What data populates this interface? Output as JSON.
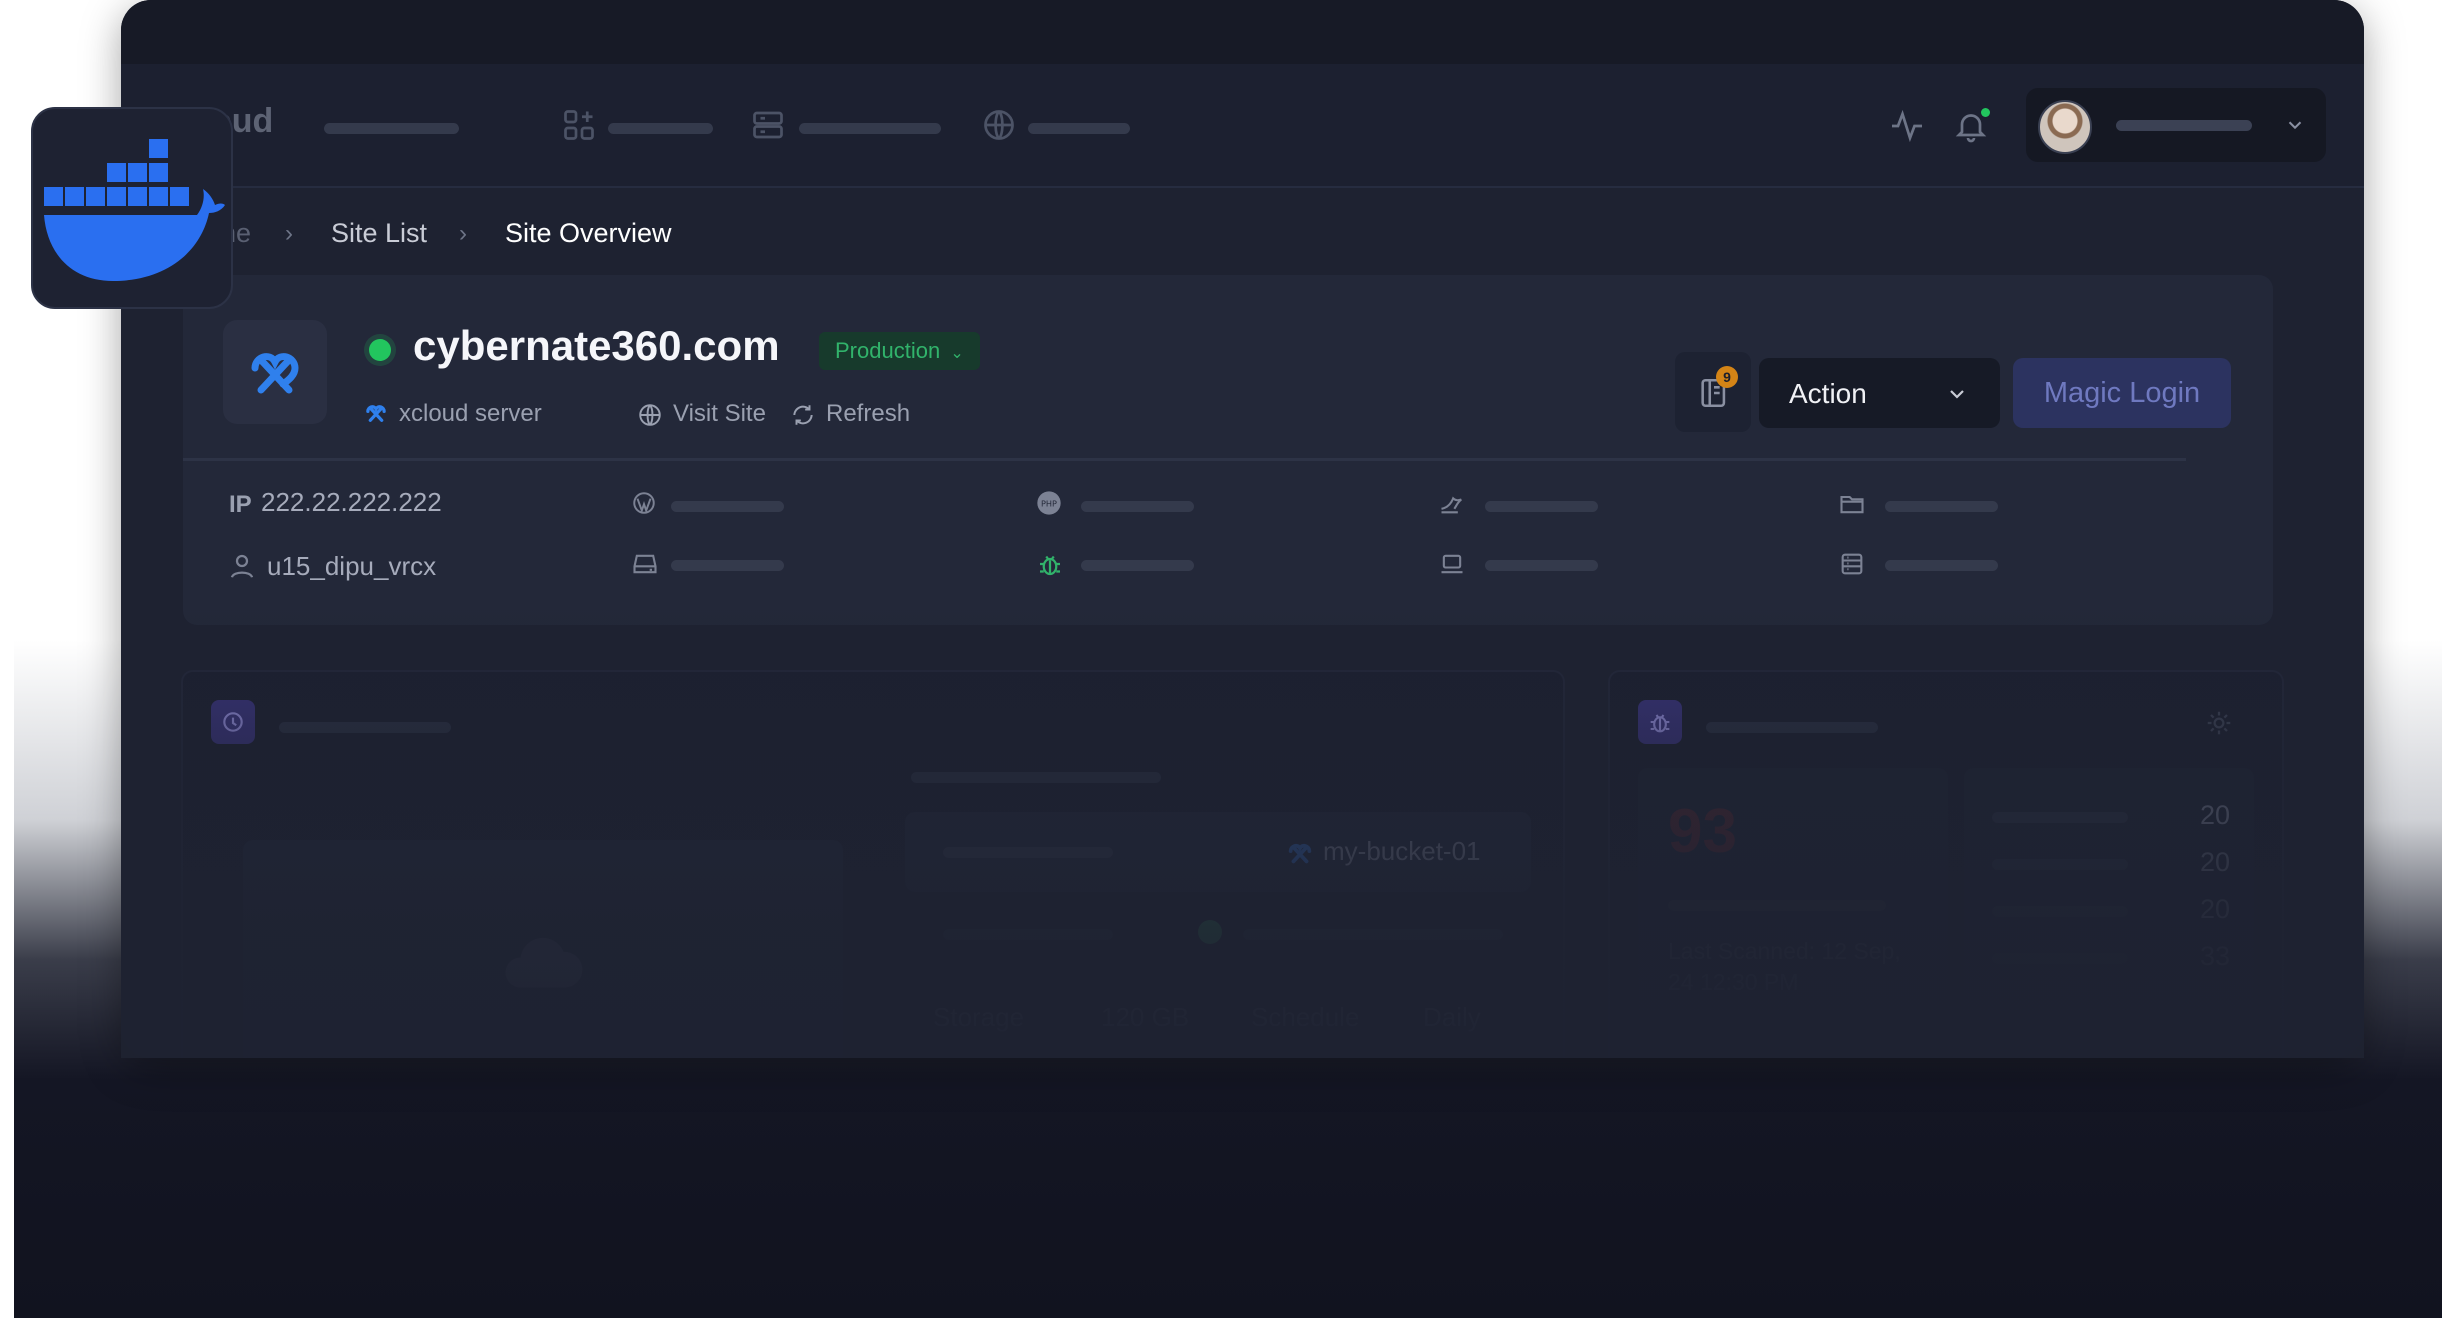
{
  "brand": {
    "partial_name": "oud"
  },
  "breadcrumb": {
    "home_partial": "ne",
    "site_list": "Site List",
    "current": "Site Overview"
  },
  "site": {
    "domain": "cybernate360.com",
    "environment": "Production",
    "server_name": "xcloud server",
    "visit_label": "Visit Site",
    "refresh_label": "Refresh",
    "ip_label": "IP",
    "ip": "222.22.222.222",
    "user": "u15_dipu_vrcx"
  },
  "actions": {
    "notification_count": "9",
    "action_label": "Action",
    "magic_login_label": "Magic Login"
  },
  "backup": {
    "bucket": "my-bucket-01",
    "storage_label": "Storage",
    "storage_value": "120 GB",
    "schedule_label": "Schedule",
    "schedule_value": "Daily"
  },
  "security": {
    "score": "93",
    "last_scanned": "Last Scanned: 12 Sep, 24 12:30 PM",
    "counts": [
      "20",
      "20",
      "20",
      "33"
    ]
  },
  "colors": {
    "status_green": "#22c55e",
    "accent_blue": "#2f80ed",
    "docker_blue": "#2a6ff0",
    "warning_orange": "#d48416"
  }
}
